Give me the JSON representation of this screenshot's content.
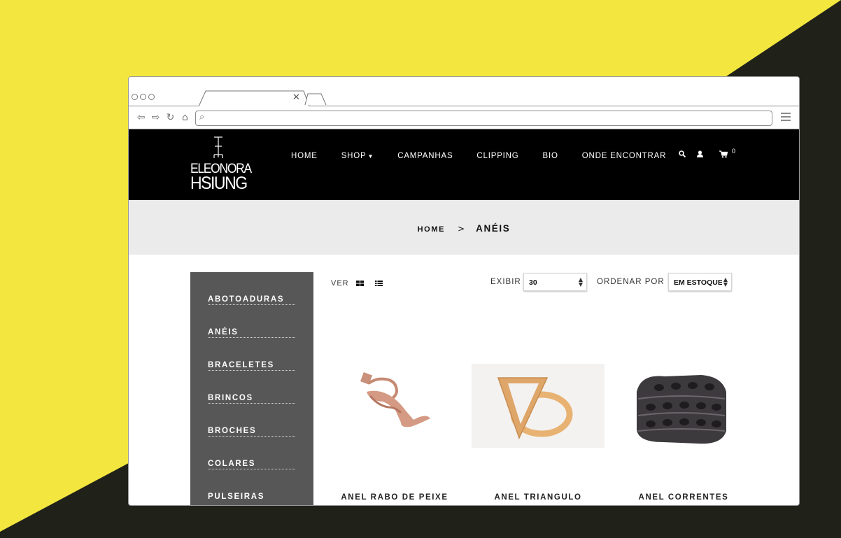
{
  "colors": {
    "background_yellow": "#f3e73f",
    "background_dark": "#20221a",
    "header_bg": "#000000",
    "crumb_bg": "#ebebeb",
    "sidebar_bg": "#575757"
  },
  "browser": {
    "url": "",
    "icons": [
      "back-arrow-icon",
      "forward-arrow-icon",
      "reload-icon",
      "home-icon",
      "search-icon",
      "hamburger-menu-icon"
    ],
    "tab_close": "✕"
  },
  "site": {
    "logo_line1": "ELEONORA",
    "logo_line2": "HSIUNG",
    "nav": [
      {
        "label": "HOME"
      },
      {
        "label": "SHOP",
        "dropdown": true
      },
      {
        "label": "CAMPANHAS"
      },
      {
        "label": "CLIPPING"
      },
      {
        "label": "BIO"
      },
      {
        "label": "ONDE ENCONTRAR"
      }
    ],
    "cart_count": "0"
  },
  "breadcrumb": {
    "home": "HOME",
    "separator": ">",
    "current": "ANÉIS"
  },
  "sidebar": {
    "categories": [
      "ABOTOADURAS",
      "ANÉIS",
      "BRACELETES",
      "BRINCOS",
      "BROCHES",
      "COLARES",
      "PULSEIRAS"
    ]
  },
  "toolbar": {
    "ver_label": "VER",
    "exibir_label": "EXIBIR",
    "exibir_value": "30",
    "ordenar_label": "ORDENAR POR",
    "ordenar_value": "EM ESTOQUE"
  },
  "products": [
    {
      "name": "ANEL RABO DE PEIXE"
    },
    {
      "name": "ANEL TRIANGULO"
    },
    {
      "name": "ANEL CORRENTES"
    }
  ]
}
